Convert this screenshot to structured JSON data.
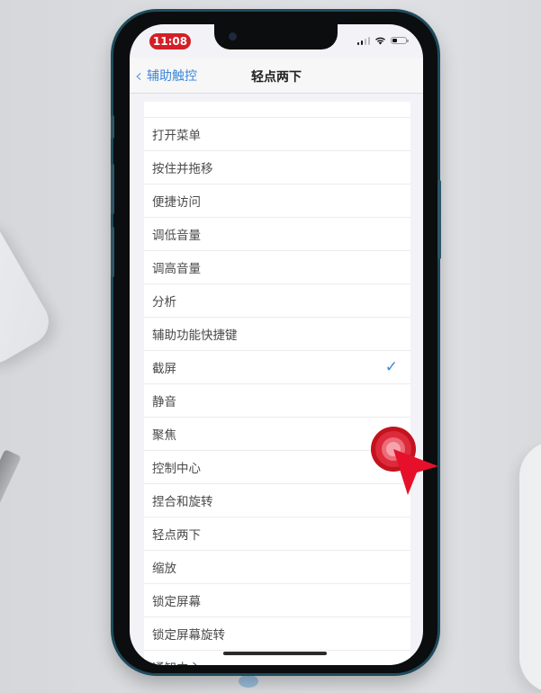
{
  "status_bar": {
    "time": "11:08",
    "time_badge_color": "#d31f27",
    "signal_icon": "cellular-signal-icon",
    "wifi_icon": "wifi-icon",
    "battery_icon": "battery-icon",
    "battery_level": 0.35
  },
  "navbar": {
    "back_label": "辅助触控",
    "back_chevron": "‹",
    "title": "轻点两下",
    "accent_color": "#3a86d8"
  },
  "list": {
    "items": [
      {
        "label": "",
        "checked": false
      },
      {
        "label": "打开菜单",
        "checked": false
      },
      {
        "label": "按住并拖移",
        "checked": false
      },
      {
        "label": "便捷访问",
        "checked": false
      },
      {
        "label": "调低音量",
        "checked": false
      },
      {
        "label": "调高音量",
        "checked": false
      },
      {
        "label": "分析",
        "checked": false
      },
      {
        "label": "辅助功能快捷键",
        "checked": false
      },
      {
        "label": "截屏",
        "checked": true
      },
      {
        "label": "静音",
        "checked": false
      },
      {
        "label": "聚焦",
        "checked": false
      },
      {
        "label": "控制中心",
        "checked": false
      },
      {
        "label": "捏合和旋转",
        "checked": false
      },
      {
        "label": "轻点两下",
        "checked": false
      },
      {
        "label": "缩放",
        "checked": false
      },
      {
        "label": "锁定屏幕",
        "checked": false
      },
      {
        "label": "锁定屏幕旋转",
        "checked": false
      },
      {
        "label": "通知中心",
        "checked": false
      }
    ],
    "checkmark": "✓"
  },
  "overlay": {
    "cursor_icon": "red-pointer-cursor-icon",
    "cursor_color": "#e0192e"
  }
}
